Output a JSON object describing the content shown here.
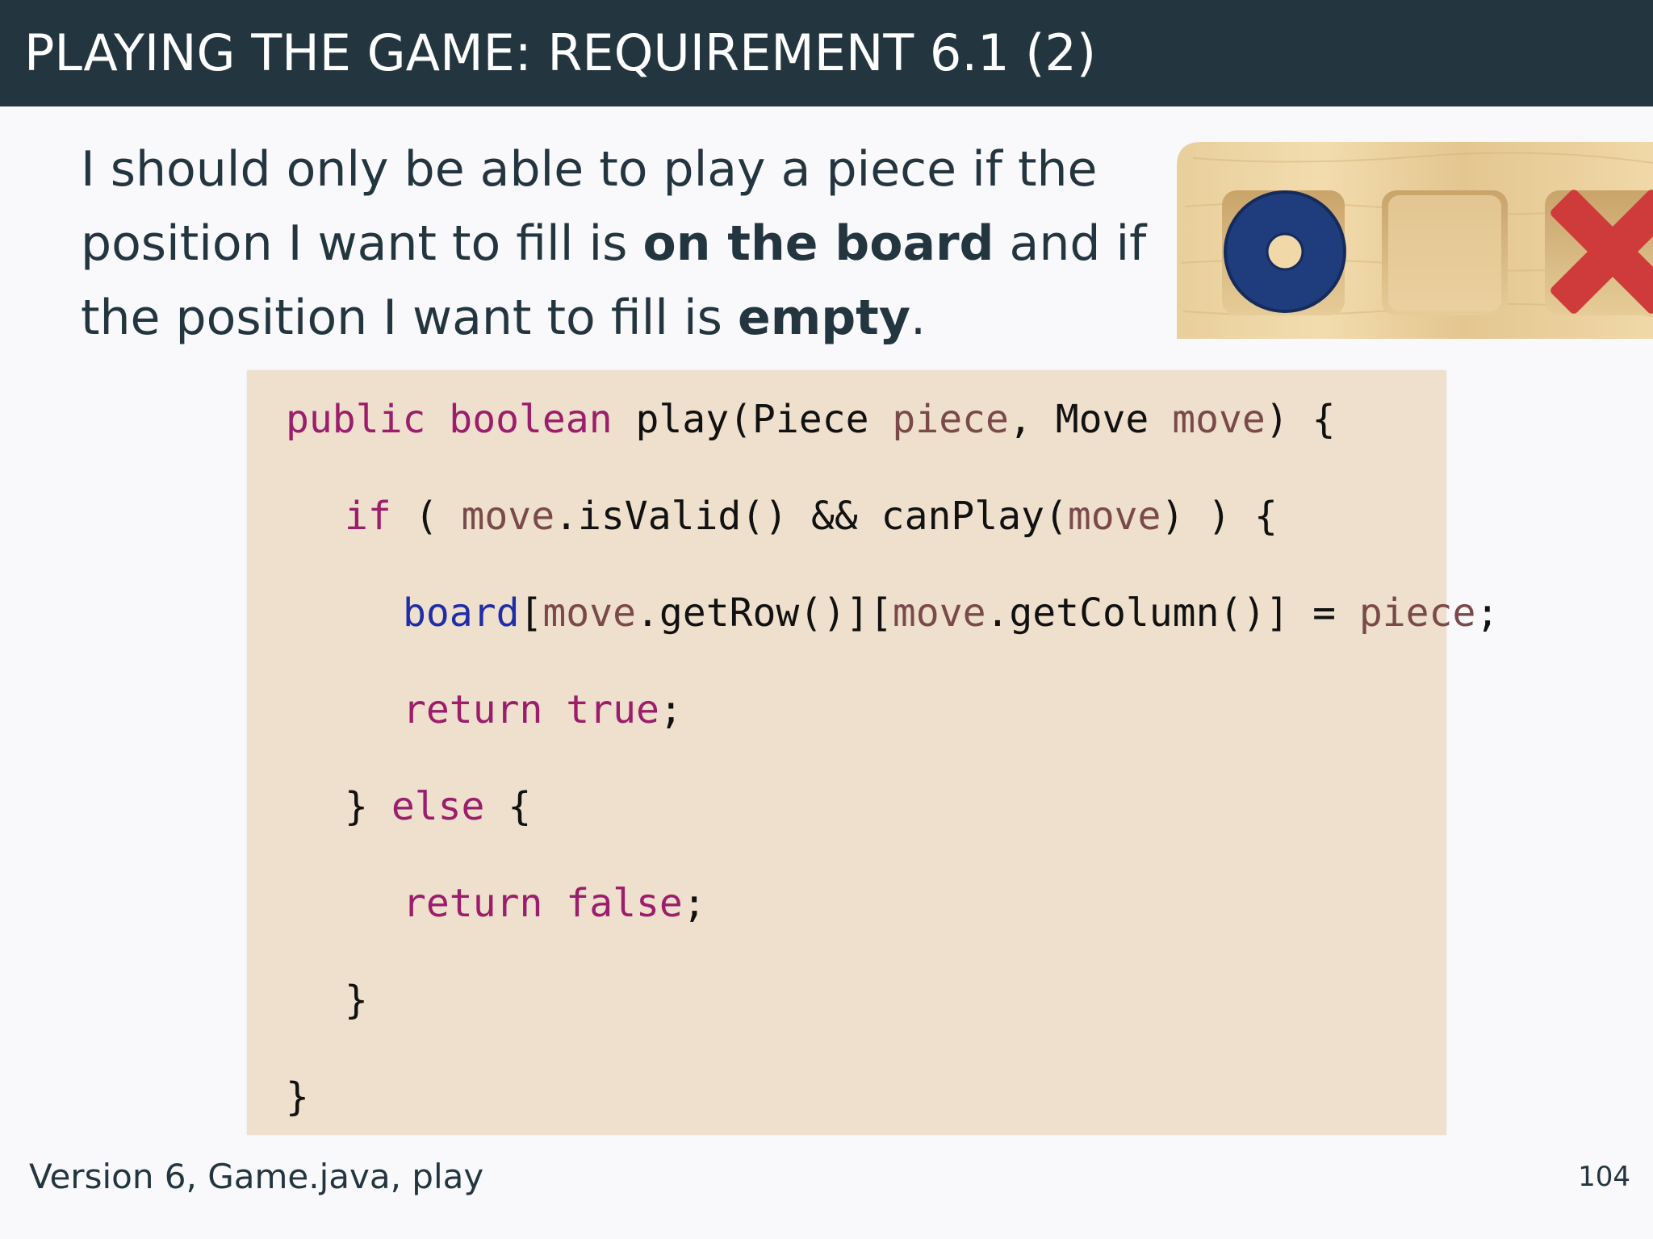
{
  "header": {
    "title": "PLAYING THE GAME: REQUIREMENT 6.1 (2)"
  },
  "intro": {
    "text_1": "I should only be able to play a piece if the position I want to fill is ",
    "bold_1": "on the board",
    "text_2": " and if the position I want to fill is ",
    "bold_2": "empty",
    "text_3": "."
  },
  "code": {
    "line_1": {
      "kw_public": "public",
      "kw_boolean": "boolean",
      "t_play": "play(Piece",
      "v_piece": "piece",
      "t_comma_move": ", Move",
      "v_move": "move",
      "t_close": ") {"
    },
    "line_2": {
      "kw_if": "if",
      "t_open": "( ",
      "v_move": "move",
      "t_isvalid": ".isValid() && canPlay(",
      "v_move2": "move",
      "t_close": ") ) {"
    },
    "line_3": {
      "f_board": "board",
      "t_br1": "[",
      "v_move": "move",
      "t_getrow": ".getRow()][",
      "v_move2": "move",
      "t_getcol": ".getColumn()] = ",
      "v_piece": "piece",
      "t_semi": ";"
    },
    "line_4": {
      "kw_return": "return",
      "kw_true": "true",
      "t_semi": ";"
    },
    "line_5": {
      "t_brace": "}",
      "kw_else": "else",
      "t_open": "{"
    },
    "line_6": {
      "kw_return": "return",
      "kw_false": "false",
      "t_semi": ";"
    },
    "line_7": {
      "t_brace": "}"
    },
    "line_8": {
      "t_brace": "}"
    }
  },
  "footer": {
    "source": "Version 6, Game.java, play",
    "page_number": "104"
  },
  "colors": {
    "header_bg": "#23363f",
    "code_bg": "#eee0cc",
    "keyword": "#9c1d6b",
    "variable": "#7a4a4a",
    "field": "#1f2ea8"
  },
  "image": {
    "icons": [
      "board-frame-icon",
      "blue-o-piece-icon",
      "empty-slot-icon",
      "red-x-piece-icon"
    ]
  }
}
